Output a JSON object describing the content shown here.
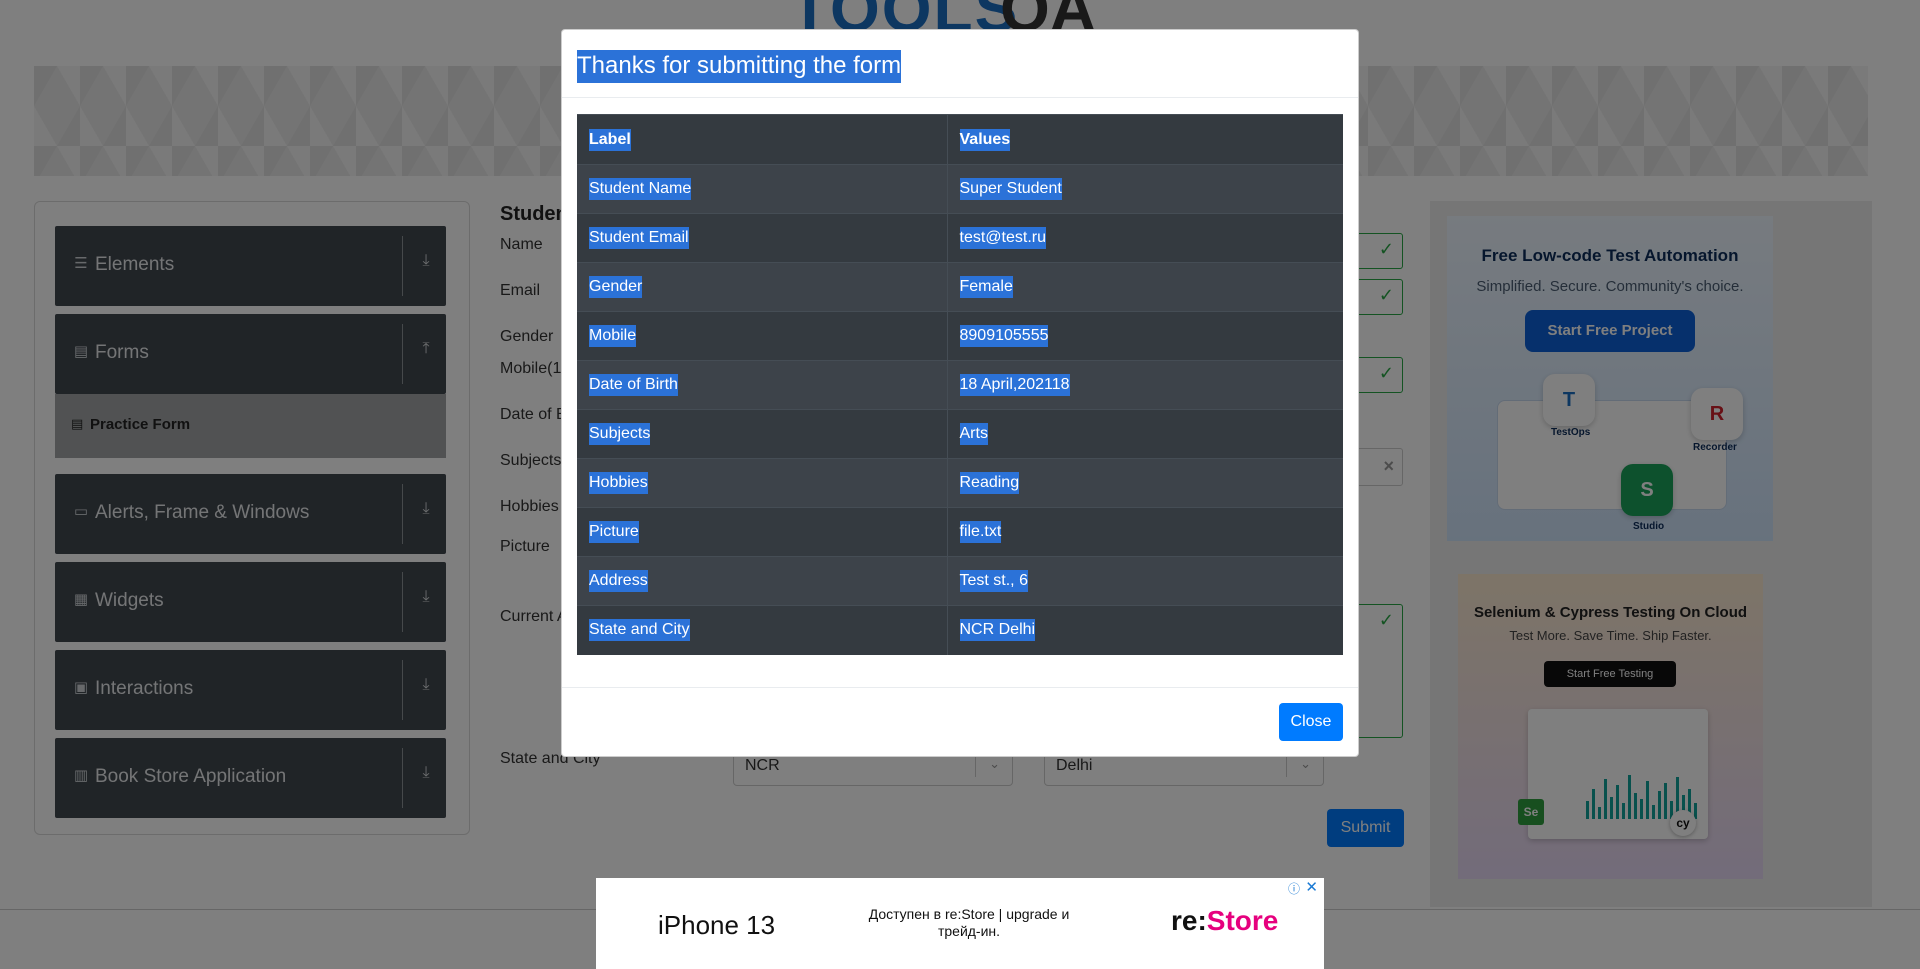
{
  "logo": {
    "text": "TOOLS",
    "text2": "QA"
  },
  "sidebar": {
    "groups": [
      {
        "label": "Elements",
        "icon": "list-icon",
        "glyph": "☰",
        "arrow": "⤓"
      },
      {
        "label": "Forms",
        "icon": "document-icon",
        "glyph": "▤",
        "arrow": "⤒"
      },
      {
        "label": "Alerts, Frame & Windows",
        "icon": "window-icon",
        "glyph": "▭",
        "arrow": "⤓"
      },
      {
        "label": "Widgets",
        "icon": "widgets-icon",
        "glyph": "▦",
        "arrow": "⤓"
      },
      {
        "label": "Interactions",
        "icon": "interactions-icon",
        "glyph": "▣",
        "arrow": "⤓"
      },
      {
        "label": "Book Store Application",
        "icon": "books-icon",
        "glyph": "▥",
        "arrow": "⤓"
      }
    ],
    "active_item": {
      "label": "Practice Form",
      "glyph": "▤"
    }
  },
  "form": {
    "heading": "Studen",
    "labels": {
      "name": "Name",
      "email": "Email",
      "gender": "Gender",
      "mobile": "Mobile(1",
      "dob": "Date of B",
      "subjects": "Subjects",
      "hobbies": "Hobbies",
      "picture": "Picture",
      "address": "Current A",
      "state_city": "State and City"
    },
    "check_glyph": "✓",
    "clear_glyph": "×",
    "state_value": "NCR",
    "city_value": "Delhi",
    "chevron": "⌄",
    "submit_label": "Submit"
  },
  "ads": {
    "ad1": {
      "title": "Free Low-code Test Automation",
      "subtitle": "Simplified. Secure. Community's choice.",
      "cta": "Start Free Project",
      "tiles": [
        {
          "letter": "T",
          "label": "TestOps"
        },
        {
          "letter": "R",
          "label": "Recorder"
        },
        {
          "letter": "S",
          "label": "Studio"
        }
      ]
    },
    "ad2": {
      "title": "Selenium & Cypress Testing On Cloud",
      "subtitle": "Test More. Save Time. Ship Faster.",
      "cta": "Start Free Testing",
      "badge1": "Se",
      "badge2": "cy"
    },
    "bottom": {
      "brand": "iPhone 13",
      "copy": "Доступен в re:Store | upgrade и трейд-ин.",
      "store_prefix": "re:",
      "store_suffix": "Store",
      "info_glyph": "ⓘ",
      "close_glyph": "✕"
    }
  },
  "modal": {
    "title": "Thanks for submitting the form",
    "headers": [
      "Label",
      "Values"
    ],
    "rows": [
      [
        "Student Name",
        "Super Student"
      ],
      [
        "Student Email",
        "test@test.ru"
      ],
      [
        "Gender",
        "Female"
      ],
      [
        "Mobile",
        "8909105555"
      ],
      [
        "Date of Birth",
        "18 April,202118"
      ],
      [
        "Subjects",
        "Arts"
      ],
      [
        "Hobbies",
        "Reading"
      ],
      [
        "Picture",
        "file.txt"
      ],
      [
        "Address",
        "Test st., 6"
      ],
      [
        "State and City",
        "NCR Delhi"
      ]
    ],
    "close_label": "Close"
  }
}
